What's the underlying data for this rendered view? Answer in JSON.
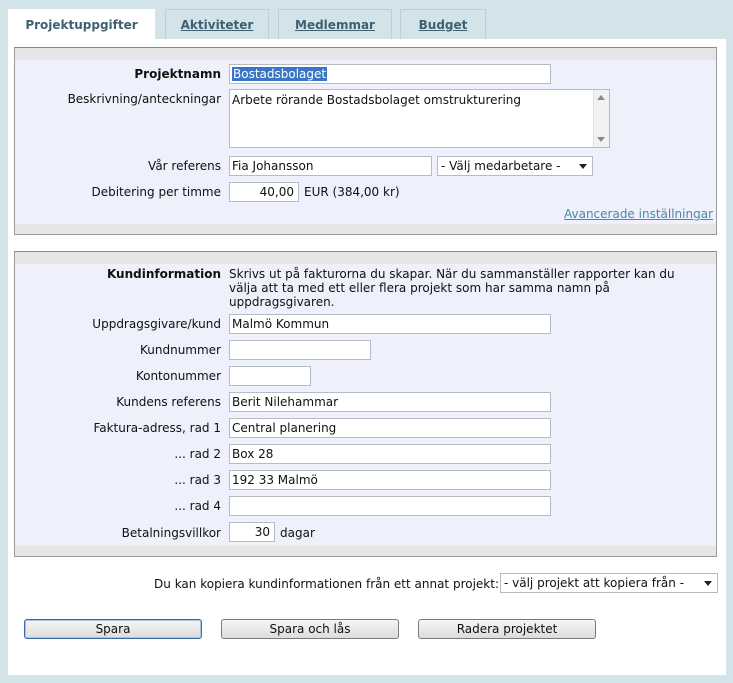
{
  "tabs": [
    {
      "label": "Projektuppgifter",
      "active": true
    },
    {
      "label": "Aktiviteter",
      "active": false
    },
    {
      "label": "Medlemmar",
      "active": false
    },
    {
      "label": "Budget",
      "active": false
    }
  ],
  "project": {
    "name_label": "Projektnamn",
    "name_value": "Bostadsbolaget",
    "description_label": "Beskrivning/anteckningar",
    "description_value": "Arbete rörande Bostadsbolaget omstrukturering",
    "reference_label": "Vår referens",
    "reference_value": "Fia Johansson",
    "reference_select": "- Välj medarbetare -",
    "rate_label": "Debitering per timme",
    "rate_value": "40,00",
    "rate_unit": "EUR (384,00 kr)",
    "advanced_link": "Avancerade inställningar"
  },
  "customer": {
    "info_label": "Kundinformation",
    "info_text_line1": "Skrivs ut på fakturorna du skapar. När du sammanställer rapporter kan du",
    "info_text_line2": "välja att ta med ett eller flera projekt som har samma namn på",
    "info_text_line3": "uppdragsgivaren.",
    "client_label": "Uppdragsgivare/kund",
    "client_value": "Malmö Kommun",
    "customer_no_label": "Kundnummer",
    "customer_no_value": "",
    "account_no_label": "Kontonummer",
    "account_no_value": "",
    "customer_ref_label": "Kundens referens",
    "customer_ref_value": "Berit Nilehammar",
    "addr1_label": "Faktura-adress, rad 1",
    "addr1_value": "Central planering",
    "addr2_label": "... rad 2",
    "addr2_value": "Box 28",
    "addr3_label": "... rad 3",
    "addr3_value": "192 33 Malmö",
    "addr4_label": "... rad 4",
    "addr4_value": "",
    "terms_label": "Betalningsvillkor",
    "terms_value": "30",
    "terms_unit": "dagar"
  },
  "copy": {
    "label": "Du kan kopiera kundinformationen från ett annat projekt:",
    "select": "- välj projekt att kopiera från -"
  },
  "buttons": {
    "save": "Spara",
    "save_lock": "Spara och lås",
    "delete": "Radera projektet"
  }
}
